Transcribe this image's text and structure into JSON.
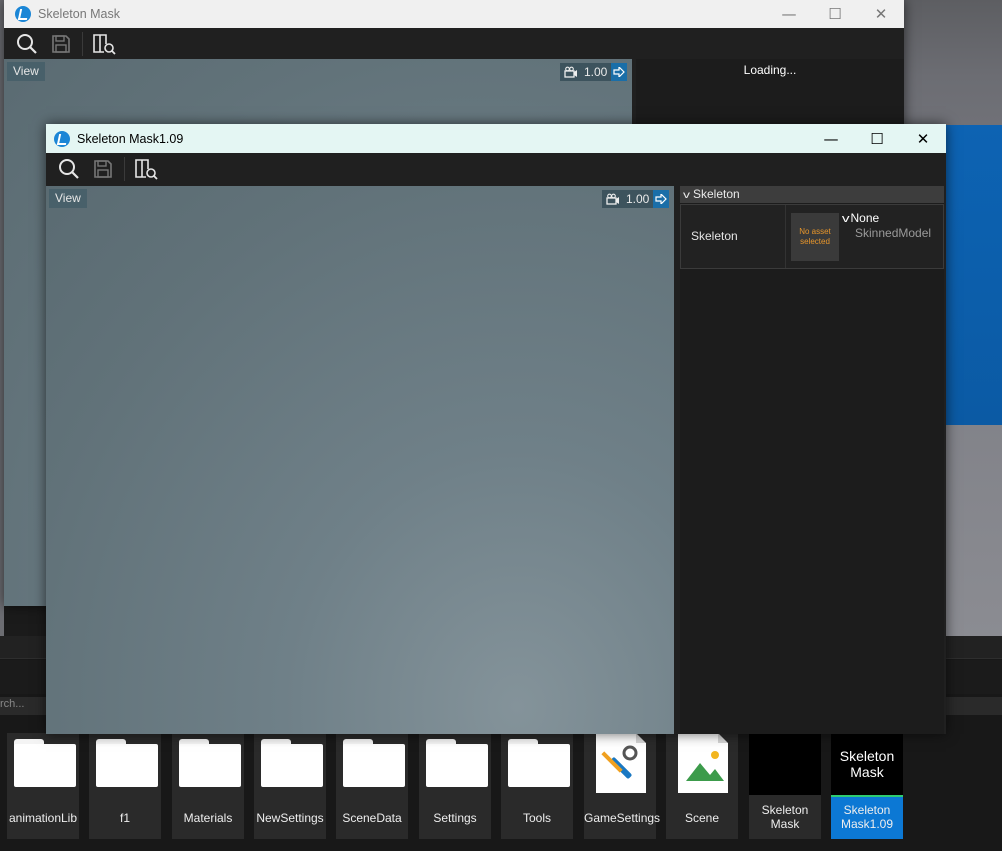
{
  "back_window": {
    "title": "Skeleton Mask",
    "controls": {
      "minimize": "—",
      "maximize": "☐",
      "close": "✕"
    },
    "view_label": "View",
    "zoom_value": "1.00",
    "loading_text": "Loading..."
  },
  "front_window": {
    "title": "Skeleton Mask1.09",
    "controls": {
      "minimize": "—",
      "maximize": "☐",
      "close": "✕"
    },
    "view_label": "View",
    "zoom_value": "1.00",
    "properties": {
      "group_title": "Skeleton",
      "row_label": "Skeleton",
      "thumb_text": "No asset selected",
      "asset_name": "None",
      "asset_type": "SkinnedModel"
    }
  },
  "content": {
    "search_placeholder": "rch...",
    "tiles": [
      {
        "label": "animationLib",
        "kind": "folder"
      },
      {
        "label": "f1",
        "kind": "folder"
      },
      {
        "label": "Materials",
        "kind": "folder"
      },
      {
        "label": "NewSettings",
        "kind": "folder"
      },
      {
        "label": "SceneData",
        "kind": "folder"
      },
      {
        "label": "Settings",
        "kind": "folder"
      },
      {
        "label": "Tools",
        "kind": "folder"
      },
      {
        "label": "GameSettings",
        "kind": "doc",
        "icon": "tools-icon"
      },
      {
        "label": "Scene",
        "kind": "doc",
        "icon": "image-icon"
      },
      {
        "label_line1": "Skeleton",
        "label_line2": "Mask",
        "kind": "black"
      },
      {
        "label_line1": "Skeleton",
        "label_line2": "Mask1.09",
        "thumb_line1": "Skeleton",
        "thumb_line2": "Mask",
        "kind": "selected"
      }
    ]
  },
  "colors": {
    "accent": "#0c78d4",
    "title_front": "#e4f6f3",
    "panel": "#202020"
  }
}
